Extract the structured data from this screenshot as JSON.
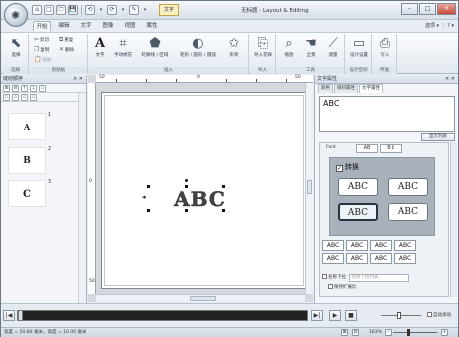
{
  "window": {
    "title": "无标题 - Layout & Editing",
    "context_tab": "文字",
    "controls": [
      "–",
      "□",
      "×"
    ]
  },
  "qat": [
    "⌂",
    "□",
    "🗁",
    "💾",
    "⟲",
    "⟳",
    "✎",
    "⚙"
  ],
  "tabs": [
    "开始",
    "编辑",
    "文字",
    "图像",
    "视图",
    "属性"
  ],
  "help": "选项 ▾ ｜ ? ▾",
  "ribbon": {
    "groups": [
      "选择",
      "剪贴板",
      "插入",
      "导入",
      "工具",
      "设计空间",
      "传送"
    ],
    "clipboard": {
      "cut": "剪切",
      "copy": "复制",
      "paste": "粘贴",
      "duplicate": "重复",
      "delete": "删除",
      "select": "选择"
    },
    "insert": [
      "文字",
      "手动绣花",
      "轮廓线 / 区域",
      "矩形 / 圆形 / 圆弧",
      "形状"
    ],
    "import": "导入花样",
    "tools": [
      "缩放",
      "全景",
      "测量"
    ],
    "design": "设计设置",
    "transfer": "写入"
  },
  "left_panel": {
    "title": "缝纫顺序",
    "close": "× ✕",
    "tool_icons": [
      "⊞",
      "⊟",
      "↑",
      "↓",
      "▫",
      "▫",
      "▫",
      "▫",
      "▫",
      "▫"
    ],
    "items": [
      {
        "glyph": "A",
        "num": "1"
      },
      {
        "glyph": "B",
        "num": "2"
      },
      {
        "glyph": "C",
        "num": "3"
      }
    ]
  },
  "canvas": {
    "ruler_labels": [
      "50",
      "0",
      "50"
    ],
    "ruler_v_labels": [
      "0",
      "50"
    ],
    "text": "ABC"
  },
  "right_panel": {
    "title": "文字属性",
    "close": "× ✕",
    "tabs": [
      "颜色",
      "缝纫属性",
      "文字属性"
    ],
    "text_value": "ABC",
    "show_list": "显示列表",
    "prop_label": "Font",
    "prop_tabs": [
      "AB",
      "B↕"
    ],
    "transform_label": "转换",
    "transform_checked": "✓",
    "name_checkbox": "名称下拉",
    "name_placeholder": "名称下拉列表...",
    "keep": "保持扩展比",
    "shapes": [
      "ABC",
      "ABC",
      "ABC",
      "ABC"
    ],
    "mini_shapes": [
      "ABC",
      "ABC",
      "ABC",
      "ABC",
      "ABC",
      "ABC",
      "ABC",
      "ABC"
    ]
  },
  "playback": {
    "buttons": [
      "|◀",
      "▶|",
      "▶",
      "■"
    ],
    "auto": "自动滚动"
  },
  "status": {
    "size": "宽度 = 50.80 毫米，高度 = 10.00 毫米",
    "zoom": "163%"
  },
  "colors": {
    "accent": "#fbefc4",
    "canvas": "#d4d8dd",
    "track": "#222222"
  }
}
